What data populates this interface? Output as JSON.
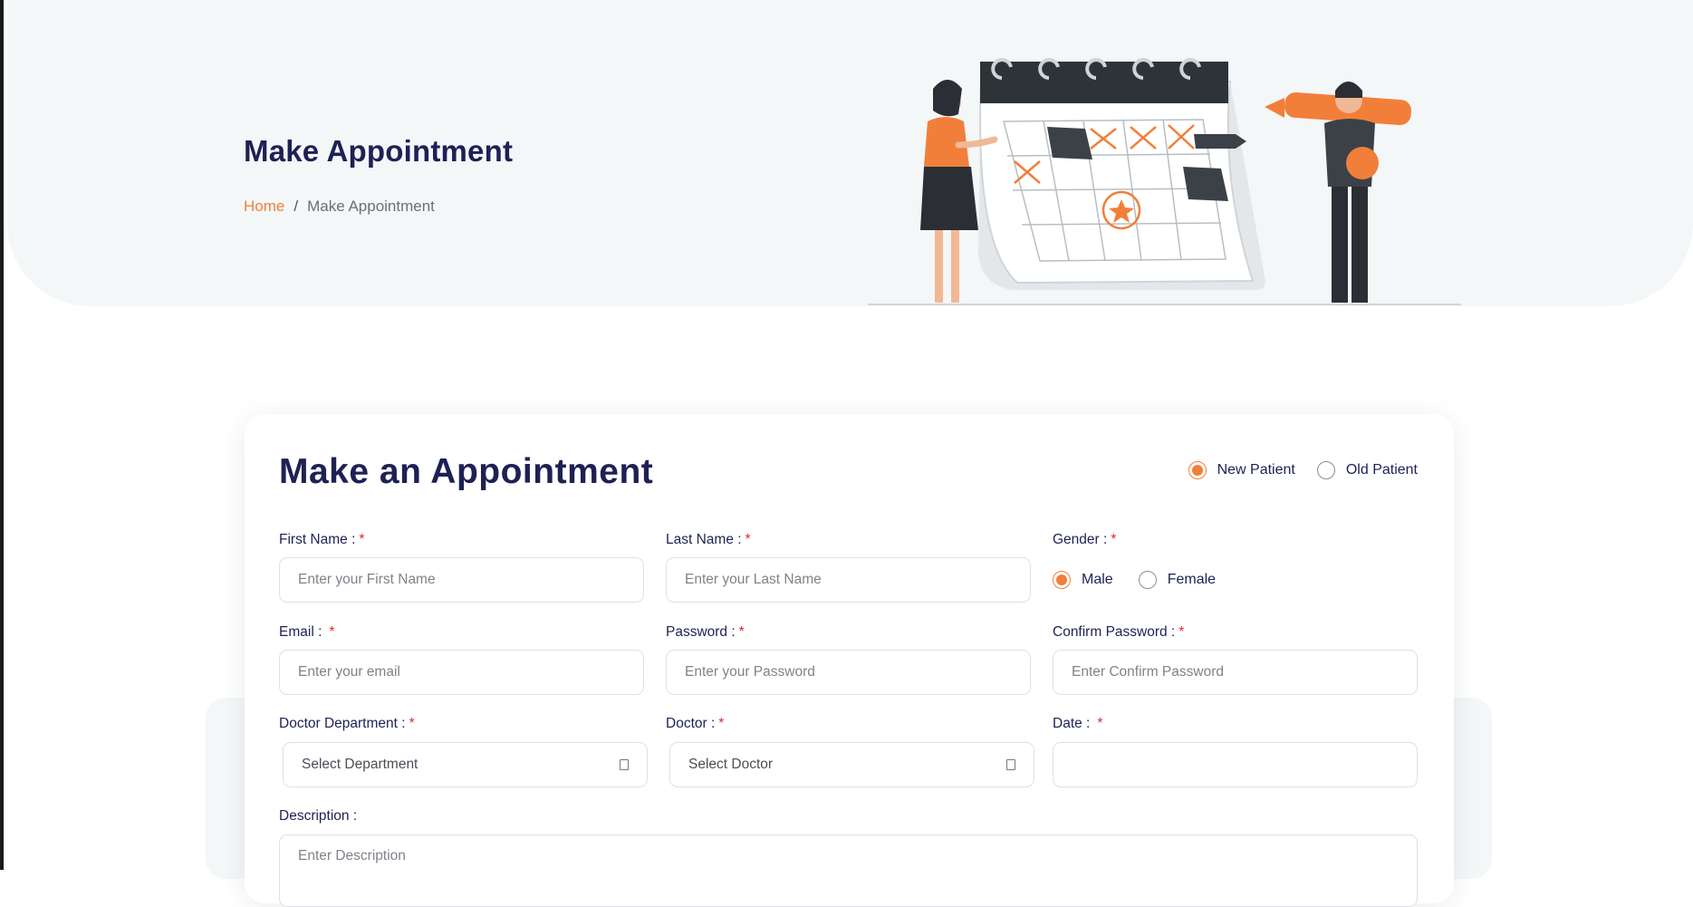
{
  "hero": {
    "title": "Make Appointment",
    "breadcrumb": {
      "home": "Home",
      "separator": "/",
      "current": "Make Appointment"
    }
  },
  "form": {
    "title": "Make an Appointment",
    "patient_type": {
      "options": [
        "New Patient",
        "Old Patient"
      ],
      "selected": "New Patient"
    },
    "first_name": {
      "label": "First Name :",
      "placeholder": "Enter your First Name"
    },
    "last_name": {
      "label": "Last Name :",
      "placeholder": "Enter your Last Name"
    },
    "gender": {
      "label": "Gender :",
      "options": [
        "Male",
        "Female"
      ],
      "selected": "Male"
    },
    "email": {
      "label": "Email :",
      "placeholder": "Enter your email"
    },
    "password": {
      "label": "Password :",
      "placeholder": "Enter your Password"
    },
    "confirm_password": {
      "label": "Confirm Password :",
      "placeholder": "Enter Confirm Password"
    },
    "department": {
      "label": "Doctor Department :",
      "value": "Select Department"
    },
    "doctor": {
      "label": "Doctor :",
      "value": "Select Doctor"
    },
    "date": {
      "label": "Date :",
      "value": ""
    },
    "description": {
      "label": "Description :",
      "placeholder": "Enter Description"
    },
    "required_mark": "*"
  },
  "colors": {
    "accent": "#f17f3a",
    "heading": "#1d2154",
    "required": "#e3262b",
    "hero_bg": "#f3f7f8"
  },
  "icons": [
    "calendar-illustration",
    "chevron-down-icon"
  ]
}
